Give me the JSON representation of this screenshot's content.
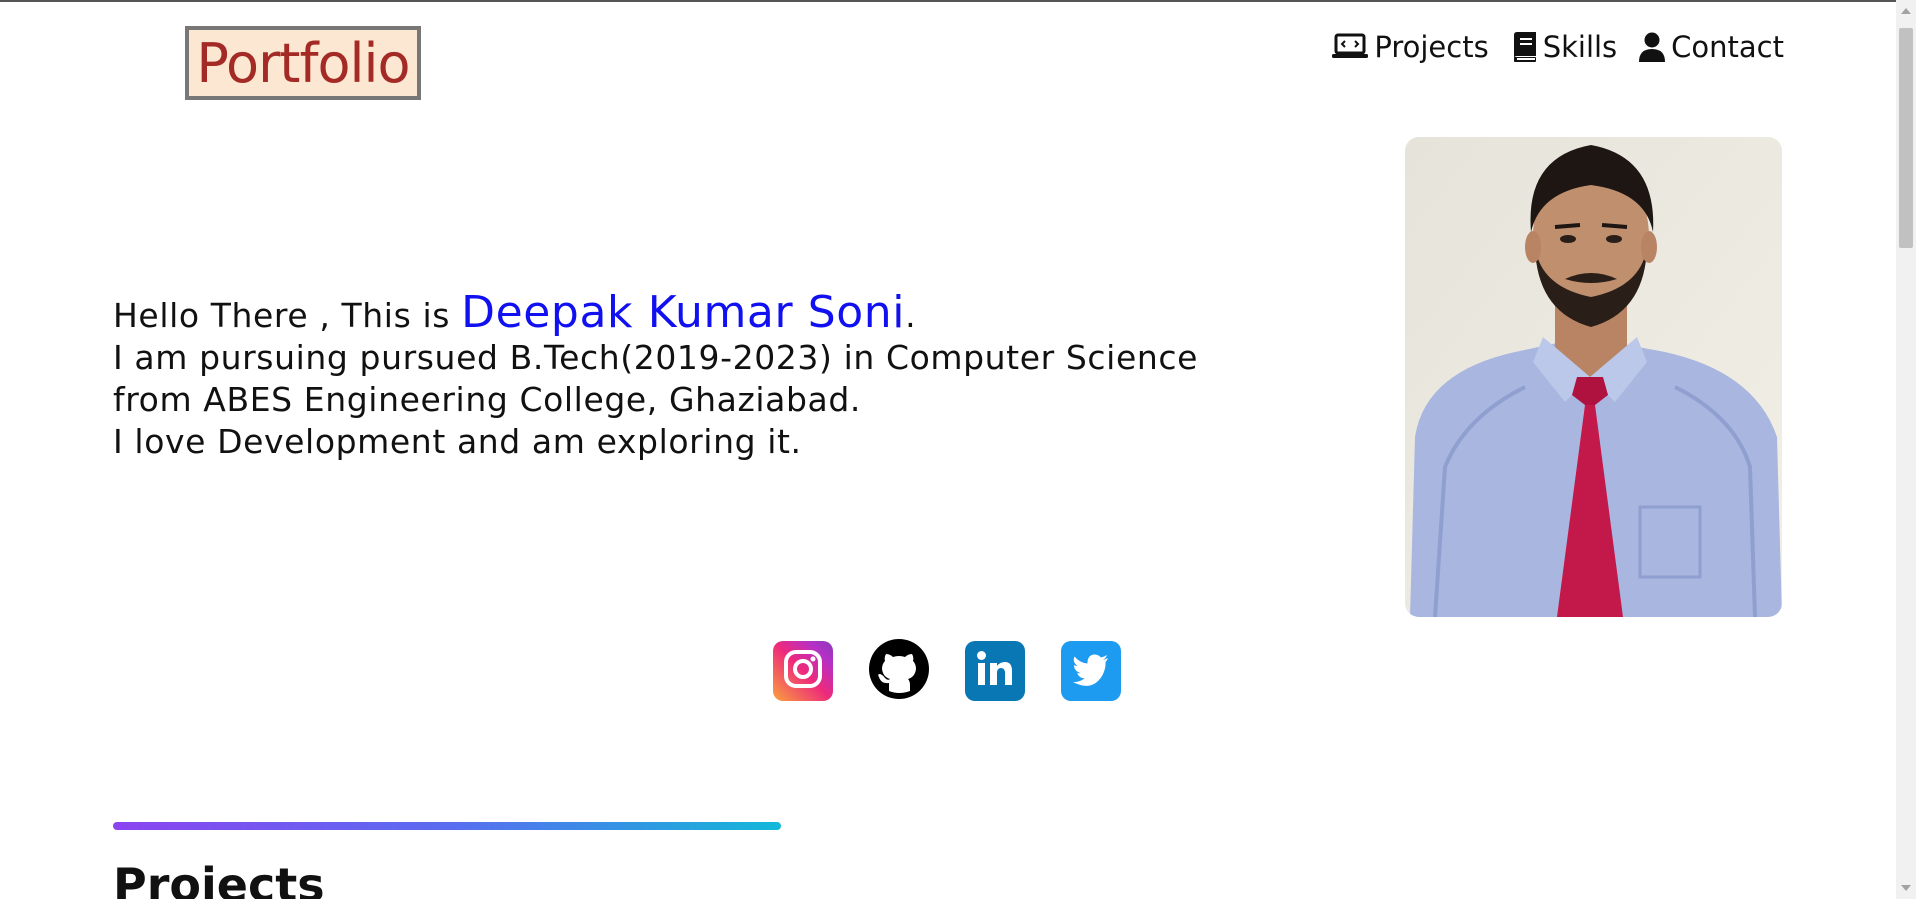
{
  "header": {
    "logo": "Portfolio",
    "nav": [
      {
        "label": "Projects",
        "icon": "laptop-code-icon"
      },
      {
        "label": "Skills",
        "icon": "book-icon"
      },
      {
        "label": "Contact",
        "icon": "user-icon"
      }
    ]
  },
  "intro": {
    "greeting": "Hello There , This is ",
    "name": "Deepak Kumar Soni",
    "name_suffix": ".",
    "line1": "I am pursuing pursued B.Tech(2019-2023) in Computer Science",
    "line2": "from ABES Engineering College, Ghaziabad.",
    "line3": "I love Development and am exploring it."
  },
  "socials": [
    {
      "icon": "instagram-icon",
      "color": "#ee2a7b"
    },
    {
      "icon": "github-icon",
      "color": "#000000"
    },
    {
      "icon": "linkedin-icon",
      "color": "#0a77b5"
    },
    {
      "icon": "twitter-icon",
      "color": "#1d9bf0"
    }
  ],
  "section": {
    "title": "Projects"
  },
  "colors": {
    "logo_text": "#a42a26",
    "logo_bg": "#fce8d2",
    "name": "#1010f0",
    "divider_start": "#8b44f0",
    "divider_end": "#12b8d8"
  }
}
